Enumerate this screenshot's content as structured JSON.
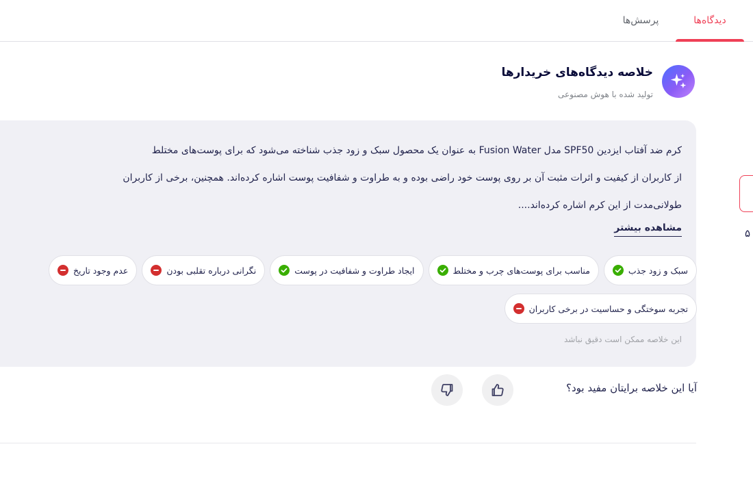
{
  "tabs": [
    {
      "label": "دیدگاه‌ها",
      "active": true
    },
    {
      "label": "پرسش‌ها",
      "active": false
    }
  ],
  "header": {
    "icon": "sparkles-icon",
    "title": "خلاصه دیدگاه‌های خریدارها",
    "subtitle": "تولید شده با هوش مصنوعی"
  },
  "summary": {
    "lines": [
      "کرم ضد آفتاب ایزدین SPF50 مدل Fusion Water به عنوان یک محصول سبک و زود جذب شناخته می‌شود که برای پوست‌های مختلط",
      "از کاربران از کیفیت و اثرات مثبت آن بر روی پوست خود راضی بوده و به طراوت و شفافیت پوست اشاره کرده‌اند. همچنین، برخی از کاربران",
      "طولانی‌مدت از این کرم اشاره کرده‌اند...."
    ],
    "more_label": "مشاهده بیشتر",
    "chips_row1": [
      {
        "label": "سبک و زود جذب",
        "type": "positive"
      },
      {
        "label": "مناسب برای پوست‌های چرب و مختلط",
        "type": "positive"
      },
      {
        "label": "ایجاد طراوت و شفافیت در پوست",
        "type": "positive"
      },
      {
        "label": "نگرانی درباره تقلبی بودن",
        "type": "negative"
      },
      {
        "label": "عدم وجود تاریخ",
        "type": "negative"
      }
    ],
    "chips_row2": [
      {
        "label": "تجربه سوختگی و حساسیت در برخی کاربران",
        "type": "negative"
      }
    ],
    "disclaimer": "این خلاصه ممکن است دقیق نباشد"
  },
  "feedback": {
    "question": "آیا این خلاصه برایتان مفید بود؟",
    "up_icon": "thumbs-up-icon",
    "down_icon": "thumbs-down-icon"
  },
  "edge": {
    "number": "۵"
  },
  "colors": {
    "accent": "#ef4056",
    "positive": "#39ae00",
    "negative": "#d32f2f",
    "card_bg": "#f0f0f5"
  }
}
